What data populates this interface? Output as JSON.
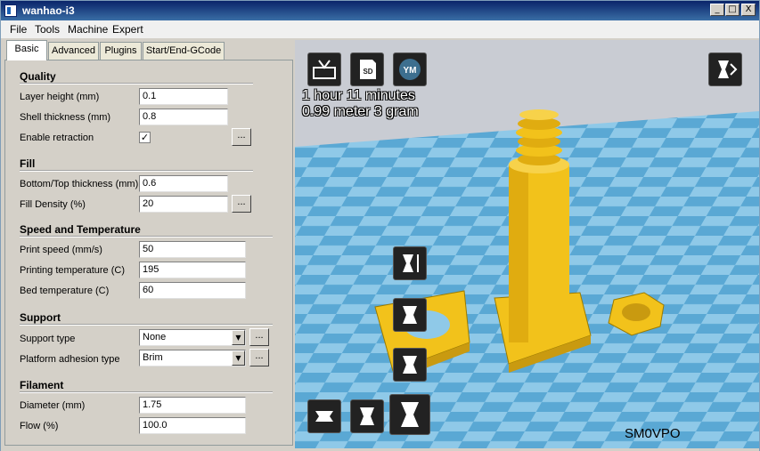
{
  "window": {
    "title": "wanhao-i3"
  },
  "titlebar_buttons": {
    "minimize": "_",
    "maximize": "□",
    "close": "X"
  },
  "menu": [
    "File",
    "Tools",
    "Machine",
    "Expert"
  ],
  "tabs": [
    "Basic",
    "Advanced",
    "Plugins",
    "Start/End-GCode"
  ],
  "sections": {
    "quality": "Quality",
    "fill": "Fill",
    "speed": "Speed and Temperature",
    "support": "Support",
    "filament": "Filament"
  },
  "fields": {
    "layer_height": {
      "label": "Layer height (mm)",
      "value": "0.1"
    },
    "shell_thickness": {
      "label": "Shell thickness (mm)",
      "value": "0.8"
    },
    "enable_retraction": {
      "label": "Enable retraction",
      "checked": "✓"
    },
    "bottom_top": {
      "label": "Bottom/Top thickness (mm)",
      "value": "0.6"
    },
    "fill_density": {
      "label": "Fill Density (%)",
      "value": "20"
    },
    "print_speed": {
      "label": "Print speed (mm/s)",
      "value": "50"
    },
    "print_temp": {
      "label": "Printing temperature (C)",
      "value": "195"
    },
    "bed_temp": {
      "label": "Bed temperature (C)",
      "value": "60"
    },
    "support_type": {
      "label": "Support type",
      "value": "None"
    },
    "adhesion": {
      "label": "Platform adhesion type",
      "value": "Brim"
    },
    "diameter": {
      "label": "Diameter (mm)",
      "value": "1.75"
    },
    "flow": {
      "label": "Flow (%)",
      "value": "100.0"
    }
  },
  "dots_label": "...",
  "view": {
    "toolbar": {
      "sd_label": "SD",
      "ym_label": "YM"
    },
    "time": "1 hour 11 minutes",
    "material": "0.99 meter 3 gram",
    "author": "SM0VPO"
  },
  "colors": {
    "model": "#f2c21b",
    "floor_light": "#8fc9e8",
    "floor_dark": "#5aa8d4",
    "title": "#0a246a"
  }
}
